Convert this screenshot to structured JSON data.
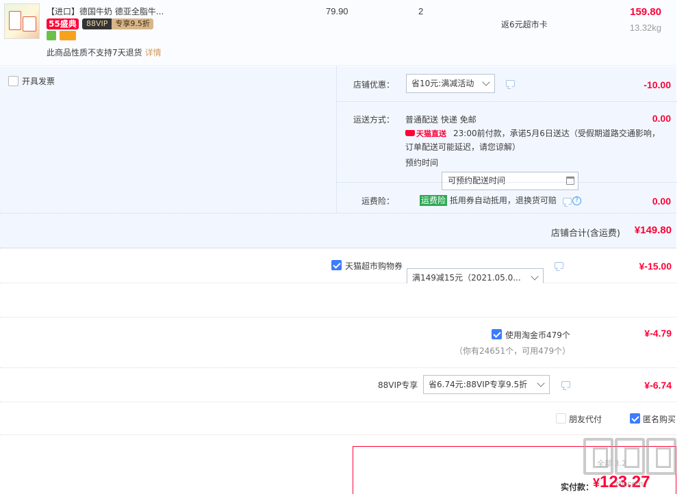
{
  "item": {
    "title": "【进口】德国牛奶 德亚全脂牛...",
    "badge_55": "55盛典",
    "badge_vip_left": "88VIP",
    "badge_vip_right": "专享9.5折",
    "return_note": "此商品性质不支持7天退货",
    "return_link": "详情",
    "unit_price": "79.90",
    "quantity": "2",
    "rebate": "返6元超市卡",
    "subtotal": "159.80",
    "weight": "13.32kg"
  },
  "invoice": {
    "label": "开具发票",
    "checked": false
  },
  "shop_discount": {
    "label": "店铺优惠：",
    "selected": "省10元:满减活动",
    "amount": "-10.00"
  },
  "shipping": {
    "label": "运送方式：",
    "method": "普通配送 快递 免邮",
    "tag": "天猫直送",
    "promise_line1": "23:00前付款，承诺5月6日送达（受假期道路交通影响，",
    "promise_line2": "订单配送可能延迟，请您谅解）",
    "appointment_label": "预约时间",
    "appointment_placeholder": "可预约配送时间",
    "amount": "0.00"
  },
  "insurance": {
    "label": "运费险：",
    "tag": "运费险",
    "text": "抵用券自动抵用，退换货可赔",
    "help": "?",
    "amount": "0.00"
  },
  "store_total": {
    "label": "店铺合计(含运费)",
    "value": "¥149.80"
  },
  "coupon": {
    "label": "天猫超市购物券",
    "selected": "满149减15元（2021.05.0...",
    "amount": "¥-15.00",
    "checked": true
  },
  "taobao_coin": {
    "label": "使用淘金币479个",
    "note": "（你有24651个，可用479个）",
    "amount": "¥-4.79",
    "checked": true
  },
  "vip88": {
    "label": "88VIP专享",
    "selected": "省6.74元:88VIP专享9.5折",
    "amount": "¥-6.74"
  },
  "friend_pay": {
    "label": "朋友代付",
    "checked": false
  },
  "anonymous": {
    "label": "匿名购买",
    "checked": true
  },
  "pay": {
    "label": "实付款：",
    "currency": "¥",
    "value": "123.27",
    "faint": "全部 3.2"
  },
  "watermark": {
    "url": "zhi.com"
  },
  "colors": {
    "accent_red": "#ff0036",
    "panel_blue": "#f2f7ff",
    "checkbox_blue": "#3d7bff",
    "tag_green": "#2fa956"
  }
}
